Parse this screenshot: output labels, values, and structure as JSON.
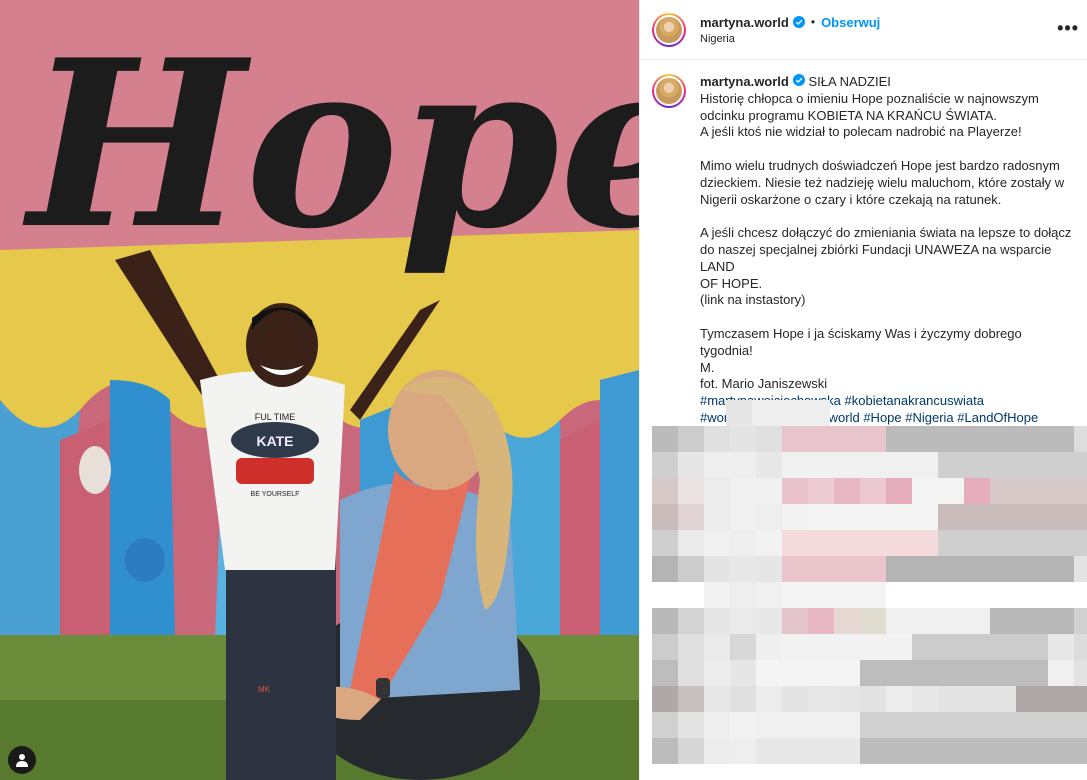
{
  "photo": {
    "wall_lettering": "Hope",
    "shirt_top": "FUL TIME",
    "shirt_mid": "KATE",
    "shirt_bottom": "BE YOURSELF",
    "shirt_patch": "MK"
  },
  "header": {
    "username": "martyna.world",
    "separator": "•",
    "follow_label": "Obserwuj",
    "location": "Nigeria",
    "more_label": "•••"
  },
  "caption": {
    "username": "martyna.world",
    "title": "SIŁA NADZIEI",
    "line1": "Historię chłopca o imieniu Hope poznaliście w najnowszym",
    "line2": "odcinku programu KOBIETA NA KRAŃCU ŚWIATA.",
    "line3": "A jeśli ktoś nie widział to polecam nadrobić na Playerze!",
    "line4": "Mimo wielu trudnych doświadczeń Hope jest bardzo radosnym",
    "line5": "dzieckiem. Niesie też nadzieję wielu maluchom, które zostały w",
    "line6": "Nigerii oskarżone o czary i które czekają na ratunek.",
    "line7": "A jeśli chcesz dołączyć do zmieniania świata na lepsze to dołącz",
    "line8": "do naszej specjalnej zbiórki Fundacji UNAWEZA na wsparcie LAND",
    "line9": "OF HOPE.",
    "line10": "(link na instastory)",
    "line11": "Tymczasem Hope i ja ściskamy Was i życzymy dobrego tygodnia!",
    "line12": "M.",
    "line13": "fot. Mario Janiszewski",
    "hashtags1": "#martynawojciechowska #kobietanakrancuswiata",
    "hashtags2": "#womanattheendoftheworld #Hope #Nigeria #LandOfHope"
  },
  "icons": {
    "tag": "person-tag-icon",
    "verified": "verified-badge-icon",
    "more": "more-options-icon"
  },
  "colors": {
    "link_blue": "#0095f6",
    "hashtag_blue": "#00376b",
    "verified_blue": "#0095f6",
    "wall_pink": "#d9798c",
    "wall_yellow": "#e8cc4a",
    "wall_blue": "#4fa7d6"
  }
}
